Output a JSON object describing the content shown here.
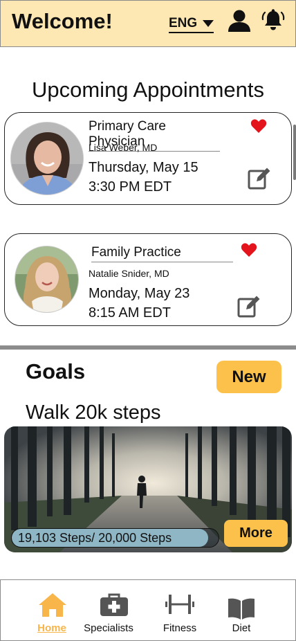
{
  "header": {
    "title": "Welcome!",
    "language": "ENG",
    "background_color": "#fde7b3"
  },
  "appointments": {
    "title": "Upcoming Appointments",
    "items": [
      {
        "specialty": "Primary Care Physician",
        "doctor": "Lisa Weber, MD",
        "date": "Thursday, May 15",
        "time": "3:30 PM EDT",
        "favorite": true
      },
      {
        "specialty": "Family Practice",
        "doctor": "Natalie Snider, MD",
        "date": "Monday, May 23",
        "time": "8:15 AM EDT",
        "favorite": true
      }
    ]
  },
  "goals": {
    "title": "Goals",
    "new_label": "New",
    "goal_name": "Walk 20k steps",
    "progress_text": "19,103 Steps/ 20,000 Steps",
    "progress_fraction": 0.95,
    "more_label": "More"
  },
  "nav": {
    "items": [
      {
        "label": "Home",
        "icon": "home-icon",
        "active": true
      },
      {
        "label": "Specialists",
        "icon": "medical-bag-icon",
        "active": false
      },
      {
        "label": "Fitness",
        "icon": "dumbbell-icon",
        "active": false
      },
      {
        "label": "Diet",
        "icon": "book-icon",
        "active": false
      }
    ]
  },
  "colors": {
    "accent": "#fbc14b",
    "active_nav": "#f7b54a",
    "heart": "#e4141c"
  }
}
